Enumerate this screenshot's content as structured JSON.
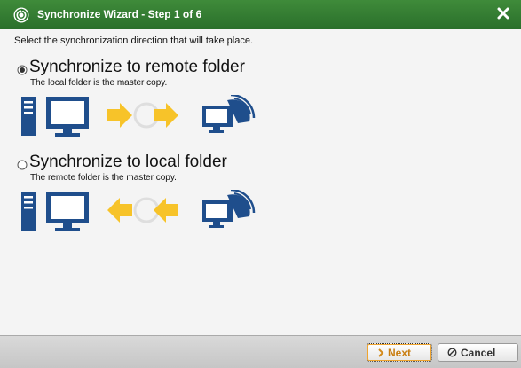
{
  "window": {
    "title": "Synchronize Wizard - Step 1 of 6",
    "title_icon": "sync-icon",
    "close_icon": "close-icon",
    "accent_color": "#2e7a2f"
  },
  "main": {
    "instruction": "Select the synchronization direction that will take place.",
    "options": [
      {
        "title": "Synchronize to remote folder",
        "description": "The local folder is the master copy.",
        "selected": true,
        "arrow_direction": "right"
      },
      {
        "title": "Synchronize to local folder",
        "description": "The remote folder is the master copy.",
        "selected": false,
        "arrow_direction": "left"
      }
    ],
    "icon_colors": {
      "computer": "#1f4e8c",
      "arrow": "#f7c329"
    }
  },
  "footer": {
    "next_label": "Next",
    "next_icon": "chevron-right-icon",
    "cancel_label": "Cancel",
    "cancel_icon": "no-entry-icon"
  }
}
